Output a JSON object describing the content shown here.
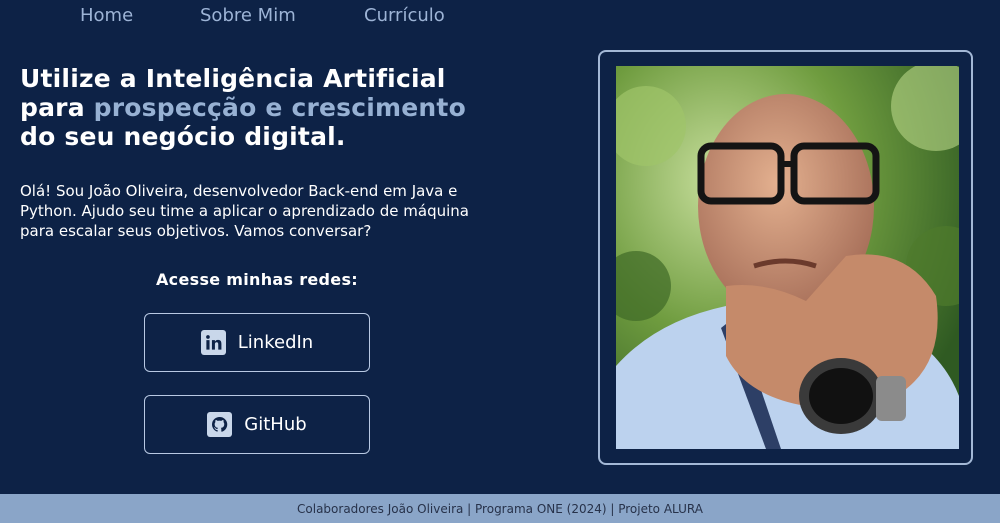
{
  "nav": {
    "items": [
      {
        "label": "Home"
      },
      {
        "label": "Sobre Mim"
      },
      {
        "label": "Currículo"
      }
    ]
  },
  "hero": {
    "headline_line1": "Utilize a Inteligência Artificial",
    "headline_para": "para ",
    "headline_accent": "prospecção e crescimento",
    "headline_line3": "do seu negócio digital.",
    "intro": "Olá! Sou João Oliveira, desenvolvedor Back-end em Java e Python. Ajudo seu time a aplicar o aprendizado de máquina para escalar seus objetivos. Vamos conversar?"
  },
  "social": {
    "title": "Acesse minhas redes:",
    "linkedin_label": "LinkedIn",
    "github_label": "GitHub",
    "linkedin_icon": "linkedin-icon",
    "github_icon": "github-icon"
  },
  "footer": {
    "text": "Colaboradores João Oliveira | Programa ONE (2024) | Projeto ALURA"
  },
  "colors": {
    "background": "#0d2246",
    "accent": "#97b1d3",
    "footer_bg": "#8aa5c8"
  }
}
